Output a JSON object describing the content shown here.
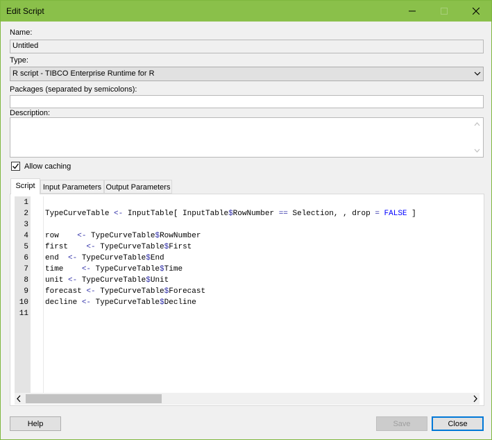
{
  "window": {
    "title": "Edit Script",
    "accent_color": "#8ac04a",
    "controls": [
      "minimize-icon",
      "maximize-icon",
      "close-icon"
    ]
  },
  "form": {
    "name_label": "Name:",
    "name_value": "Untitled",
    "type_label": "Type:",
    "type_value": "R script - TIBCO Enterprise Runtime for R",
    "packages_label": "Packages (separated by semicolons):",
    "packages_value": "",
    "description_label": "Description:",
    "description_value": "",
    "allow_caching_label": "Allow caching",
    "allow_caching_checked": true
  },
  "tabs": [
    {
      "label": "Script",
      "active": true
    },
    {
      "label": "Input Parameters",
      "active": false
    },
    {
      "label": "Output Parameters",
      "active": false
    }
  ],
  "script": {
    "line_numbers": [
      "1",
      "2",
      "3",
      "4",
      "5",
      "6",
      "7",
      "8",
      "9",
      "10",
      "11"
    ],
    "lines": [
      [],
      [
        [
          "TypeCurveTable ",
          "plain"
        ],
        [
          "<-",
          "op"
        ],
        [
          " InputTable[ InputTable",
          "plain"
        ],
        [
          "$",
          "op"
        ],
        [
          "RowNumber ",
          "plain"
        ],
        [
          "==",
          "op"
        ],
        [
          " Selection, , drop ",
          "plain"
        ],
        [
          "=",
          "op"
        ],
        [
          " ",
          "plain"
        ],
        [
          "FALSE",
          "kw"
        ],
        [
          " ]",
          "plain"
        ]
      ],
      [],
      [
        [
          "row    ",
          "plain"
        ],
        [
          "<-",
          "op"
        ],
        [
          " TypeCurveTable",
          "plain"
        ],
        [
          "$",
          "op"
        ],
        [
          "RowNumber",
          "plain"
        ]
      ],
      [
        [
          "first    ",
          "plain"
        ],
        [
          "<-",
          "op"
        ],
        [
          " TypeCurveTable",
          "plain"
        ],
        [
          "$",
          "op"
        ],
        [
          "First",
          "plain"
        ]
      ],
      [
        [
          "end  ",
          "plain"
        ],
        [
          "<-",
          "op"
        ],
        [
          " TypeCurveTable",
          "plain"
        ],
        [
          "$",
          "op"
        ],
        [
          "End",
          "plain"
        ]
      ],
      [
        [
          "time    ",
          "plain"
        ],
        [
          "<-",
          "op"
        ],
        [
          " TypeCurveTable",
          "plain"
        ],
        [
          "$",
          "op"
        ],
        [
          "Time",
          "plain"
        ]
      ],
      [
        [
          "unit ",
          "plain"
        ],
        [
          "<-",
          "op"
        ],
        [
          " TypeCurveTable",
          "plain"
        ],
        [
          "$",
          "op"
        ],
        [
          "Unit",
          "plain"
        ]
      ],
      [
        [
          "forecast ",
          "plain"
        ],
        [
          "<-",
          "op"
        ],
        [
          " TypeCurveTable",
          "plain"
        ],
        [
          "$",
          "op"
        ],
        [
          "Forecast",
          "plain"
        ]
      ],
      [
        [
          "decline ",
          "plain"
        ],
        [
          "<-",
          "op"
        ],
        [
          " TypeCurveTable",
          "plain"
        ],
        [
          "$",
          "op"
        ],
        [
          "Decline",
          "plain"
        ]
      ],
      []
    ]
  },
  "buttons": {
    "help": "Help",
    "save": "Save",
    "close": "Close"
  }
}
